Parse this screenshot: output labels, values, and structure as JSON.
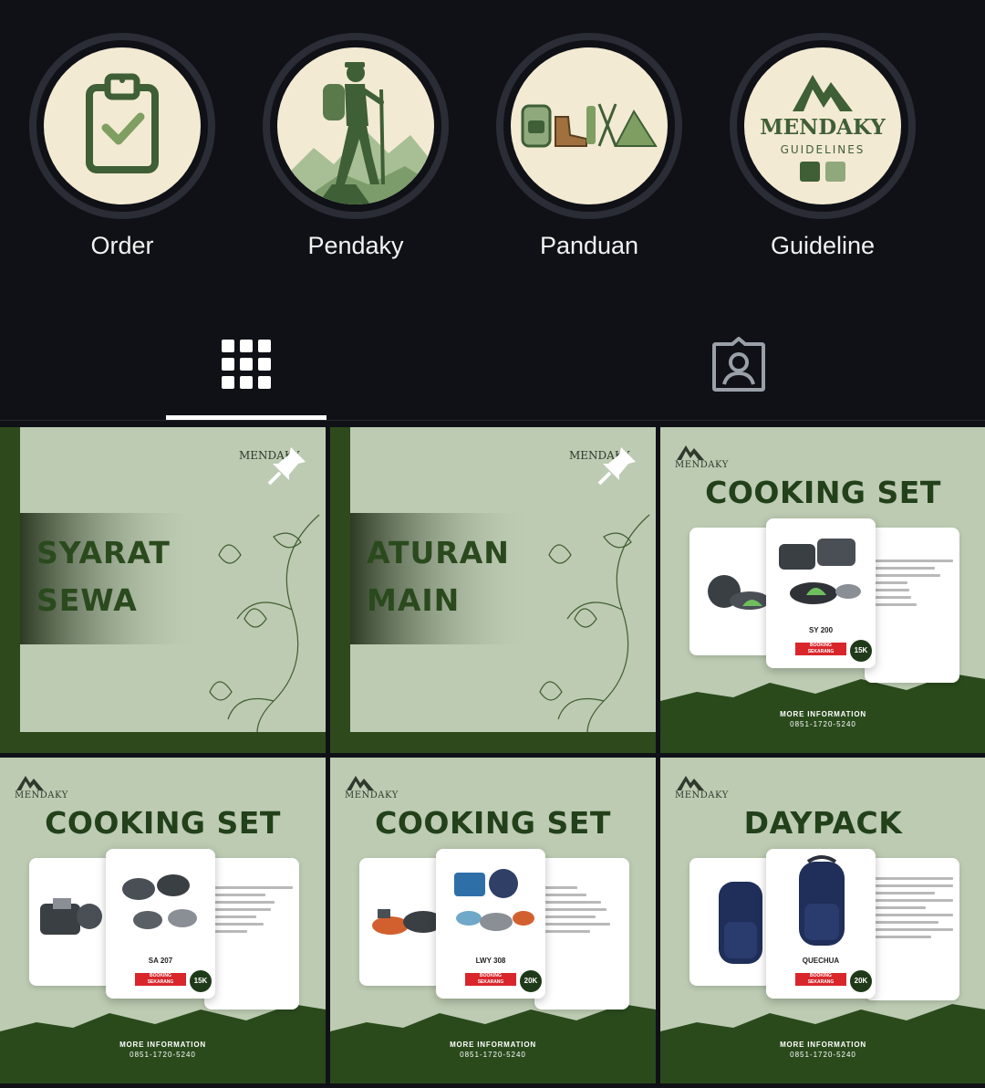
{
  "highlights": [
    {
      "label": "Order",
      "icon": "clipboard-check-icon"
    },
    {
      "label": "Pendaky",
      "icon": "hiker-icon"
    },
    {
      "label": "Panduan",
      "icon": "hiking-gear-icon"
    },
    {
      "label": "Guideline",
      "icon": "mendaky-guidelines-logo",
      "logo_text": "MENDAKY",
      "logo_sub": "GUIDELINES"
    }
  ],
  "tabs": [
    {
      "name": "posts-grid",
      "icon": "grid-icon",
      "active": true
    },
    {
      "name": "tagged",
      "icon": "tagged-person-icon",
      "active": false
    }
  ],
  "brand": {
    "name": "MENDAKY"
  },
  "posts": [
    {
      "kind": "poster",
      "title_line1": "SYARAT",
      "title_line2": "SEWA",
      "pinned": true
    },
    {
      "kind": "poster",
      "title_line1": "ATURAN",
      "title_line2": "MAIN",
      "pinned": true
    },
    {
      "kind": "product",
      "title": "COOKING SET",
      "product": "SY 200",
      "booking_line1": "BOOKING",
      "booking_line2": "SEKARANG",
      "price": "15K",
      "specs": [
        "--COOKING SET SY 200--",
        "- frying pan size 145x40mm",
        "- panci/kin size 135x73mm",
        "- 2 mangkok",
        "- 1 sendok cup",
        "- 1 sendok nasi",
        "- 1 kantong mesh"
      ],
      "more": "MORE INFORMATION",
      "phone": "0851-1720-5240"
    },
    {
      "kind": "product",
      "title": "COOKING SET",
      "product": "SA 207",
      "booking_line1": "BOOKING",
      "booking_line2": "SEKARANG",
      "price": "15K",
      "more": "MORE INFORMATION",
      "phone": "0851-1720-5240"
    },
    {
      "kind": "product",
      "title": "COOKING SET",
      "product": "LWY 308",
      "booking_line1": "BOOKING",
      "booking_line2": "SEKARANG",
      "price": "20K",
      "more": "MORE INFORMATION",
      "phone": "0851-1720-5240"
    },
    {
      "kind": "product",
      "title": "DAYPACK",
      "product": "QUECHUA",
      "booking_line1": "BOOKING",
      "booking_line2": "SEKARANG",
      "price": "20K",
      "more": "MORE INFORMATION",
      "phone": "0851-1720-5240"
    }
  ],
  "colors": {
    "background": "#0f1117",
    "highlight_disc": "#f3ead3",
    "brand_green": "#22401a",
    "tile_sage": "#bccbb2",
    "accent_red": "#d9262b"
  }
}
